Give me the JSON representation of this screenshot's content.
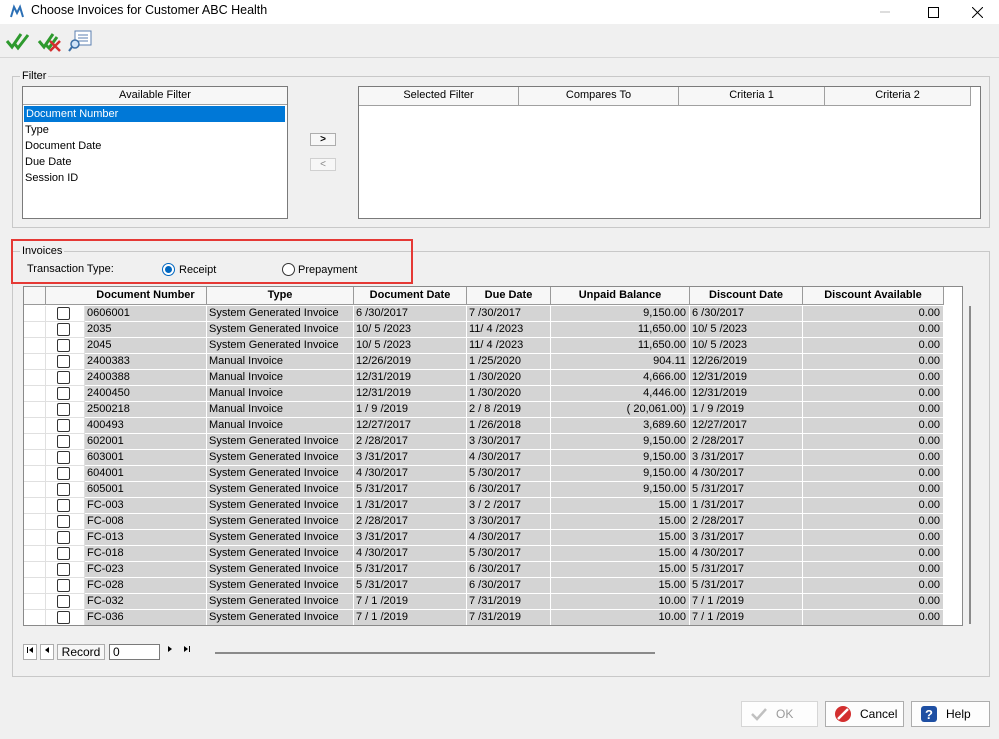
{
  "window": {
    "title": "Choose Invoices for Customer ABC Health"
  },
  "toolbar": {
    "icons": [
      "select-all-icon",
      "clear-all-icon",
      "preview-icon"
    ]
  },
  "filter": {
    "group_label": "Filter",
    "available_header": "Available Filter",
    "available_items": [
      "Document Number",
      "Type",
      "Document Date",
      "Due Date",
      "Session ID"
    ],
    "add_label": ">",
    "remove_label": "<",
    "selected_columns": [
      "Selected Filter",
      "Compares To",
      "Criteria 1",
      "Criteria 2"
    ]
  },
  "invoices": {
    "group_label": "Invoices",
    "transaction_type_label": "Transaction Type:",
    "receipt_label": "Receipt",
    "prepayment_label": "Prepayment",
    "selected_type": "Receipt",
    "columns": [
      "Document Number",
      "Type",
      "Document Date",
      "Due Date",
      "Unpaid Balance",
      "Discount Date",
      "Discount Available"
    ],
    "rows": [
      [
        "0606001",
        "System Generated Invoice",
        "6 /30/2017",
        "7 /30/2017",
        "9,150.00",
        "6 /30/2017",
        "0.00"
      ],
      [
        "2035",
        "System Generated Invoice",
        "10/ 5 /2023",
        "11/ 4 /2023",
        "11,650.00",
        "10/ 5 /2023",
        "0.00"
      ],
      [
        "2045",
        "System Generated Invoice",
        "10/ 5 /2023",
        "11/ 4 /2023",
        "11,650.00",
        "10/ 5 /2023",
        "0.00"
      ],
      [
        "2400383",
        "Manual Invoice",
        "12/26/2019",
        "1 /25/2020",
        "904.11",
        "12/26/2019",
        "0.00"
      ],
      [
        "2400388",
        "Manual Invoice",
        "12/31/2019",
        "1 /30/2020",
        "4,666.00",
        "12/31/2019",
        "0.00"
      ],
      [
        "2400450",
        "Manual Invoice",
        "12/31/2019",
        "1 /30/2020",
        "4,446.00",
        "12/31/2019",
        "0.00"
      ],
      [
        "2500218",
        "Manual Invoice",
        "1 / 9 /2019",
        "2 / 8 /2019",
        "( 20,061.00)",
        "1 / 9 /2019",
        "0.00"
      ],
      [
        "400493",
        "Manual Invoice",
        "12/27/2017",
        "1 /26/2018",
        "3,689.60",
        "12/27/2017",
        "0.00"
      ],
      [
        "602001",
        "System Generated Invoice",
        "2 /28/2017",
        "3 /30/2017",
        "9,150.00",
        "2 /28/2017",
        "0.00"
      ],
      [
        "603001",
        "System Generated Invoice",
        "3 /31/2017",
        "4 /30/2017",
        "9,150.00",
        "3 /31/2017",
        "0.00"
      ],
      [
        "604001",
        "System Generated Invoice",
        "4 /30/2017",
        "5 /30/2017",
        "9,150.00",
        "4 /30/2017",
        "0.00"
      ],
      [
        "605001",
        "System Generated Invoice",
        "5 /31/2017",
        "6 /30/2017",
        "9,150.00",
        "5 /31/2017",
        "0.00"
      ],
      [
        "FC-003",
        "System Generated Invoice",
        "1 /31/2017",
        "3 / 2 /2017",
        "15.00",
        "1 /31/2017",
        "0.00"
      ],
      [
        "FC-008",
        "System Generated Invoice",
        "2 /28/2017",
        "3 /30/2017",
        "15.00",
        "2 /28/2017",
        "0.00"
      ],
      [
        "FC-013",
        "System Generated Invoice",
        "3 /31/2017",
        "4 /30/2017",
        "15.00",
        "3 /31/2017",
        "0.00"
      ],
      [
        "FC-018",
        "System Generated Invoice",
        "4 /30/2017",
        "5 /30/2017",
        "15.00",
        "4 /30/2017",
        "0.00"
      ],
      [
        "FC-023",
        "System Generated Invoice",
        "5 /31/2017",
        "6 /30/2017",
        "15.00",
        "5 /31/2017",
        "0.00"
      ],
      [
        "FC-028",
        "System Generated Invoice",
        "5 /31/2017",
        "6 /30/2017",
        "15.00",
        "5 /31/2017",
        "0.00"
      ],
      [
        "FC-032",
        "System Generated Invoice",
        "7 / 1 /2019",
        "7 /31/2019",
        "10.00",
        "7 / 1 /2019",
        "0.00"
      ],
      [
        "FC-036",
        "System Generated Invoice",
        "7 / 1 /2019",
        "7 /31/2019",
        "10.00",
        "7 / 1 /2019",
        "0.00"
      ]
    ]
  },
  "navigator": {
    "record_label": "Record",
    "record_value": "0"
  },
  "buttons": {
    "ok": "OK",
    "cancel": "Cancel",
    "help": "Help"
  },
  "colors": {
    "selection": "#0078d7",
    "highlight_border": "#e53935",
    "row_fill": "#d4d4d4"
  }
}
